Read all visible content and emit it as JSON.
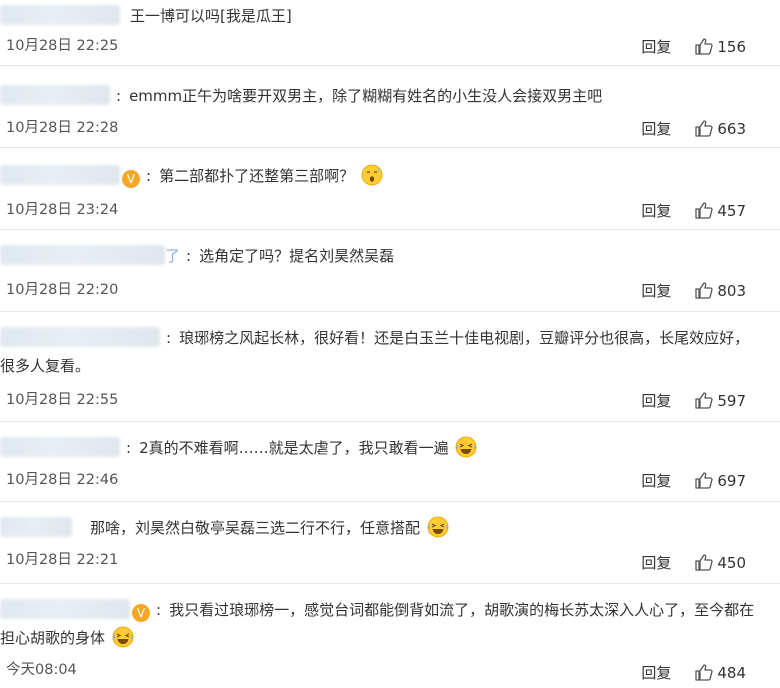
{
  "comments": [
    {
      "name_blur_w": 120,
      "text": "王一博可以吗[我是瓜王]",
      "time": "10月28日 22:25",
      "reply": "回复",
      "likes": "156",
      "verified": false,
      "emoji": ""
    },
    {
      "name_blur_w": 110,
      "text": "emmm正午为啥要开双男主，除了糊糊有姓名的小生没人会接双男主吧",
      "time": "10月28日 22:28",
      "reply": "回复",
      "likes": "663",
      "verified": false,
      "emoji": ""
    },
    {
      "name_blur_w": 120,
      "text": "第二部都扑了还整第三部啊？",
      "time": "10月28日 23:24",
      "reply": "回复",
      "likes": "457",
      "verified": true,
      "emoji": "sweat-emoji"
    },
    {
      "name_blur_w": 165,
      "text": "选角定了吗？提名刘昊然吴磊",
      "time": "10月28日 22:20",
      "reply": "回复",
      "likes": "803",
      "verified": false,
      "emoji": ""
    },
    {
      "name_blur_w": 160,
      "text": "琅琊榜之风起长林，很好看！还是白玉兰十佳电视剧，豆瓣评分也很高，长尾效应好，很多人复看。",
      "time": "10月28日 22:55",
      "reply": "回复",
      "likes": "597",
      "verified": false,
      "emoji": ""
    },
    {
      "name_blur_w": 120,
      "text": "2真的不难看啊……就是太虐了，我只敢看一遍",
      "time": "10月28日 22:46",
      "reply": "回复",
      "likes": "697",
      "verified": false,
      "emoji": "laugh-cry-emoji"
    },
    {
      "name_blur_w": 72,
      "text": "那啥，刘昊然白敬亭吴磊三选二行不行，任意搭配",
      "time": "10月28日 22:21",
      "reply": "回复",
      "likes": "450",
      "verified": false,
      "emoji": "laugh-cry-emoji"
    },
    {
      "name_blur_w": 130,
      "text": "我只看过琅琊榜一，感觉台词都能倒背如流了，胡歌演的梅长苏太深入人心了，至今都在担心胡歌的身体",
      "time": "今天08:04",
      "reply": "回复",
      "likes": "484",
      "verified": true,
      "emoji": "laugh-cry-emoji"
    }
  ],
  "icons": {
    "thumb": "thumbs-up-icon",
    "verified": "verified-v-icon",
    "verified_color": "#f5a623",
    "blur_color": "#e3eaf2"
  }
}
